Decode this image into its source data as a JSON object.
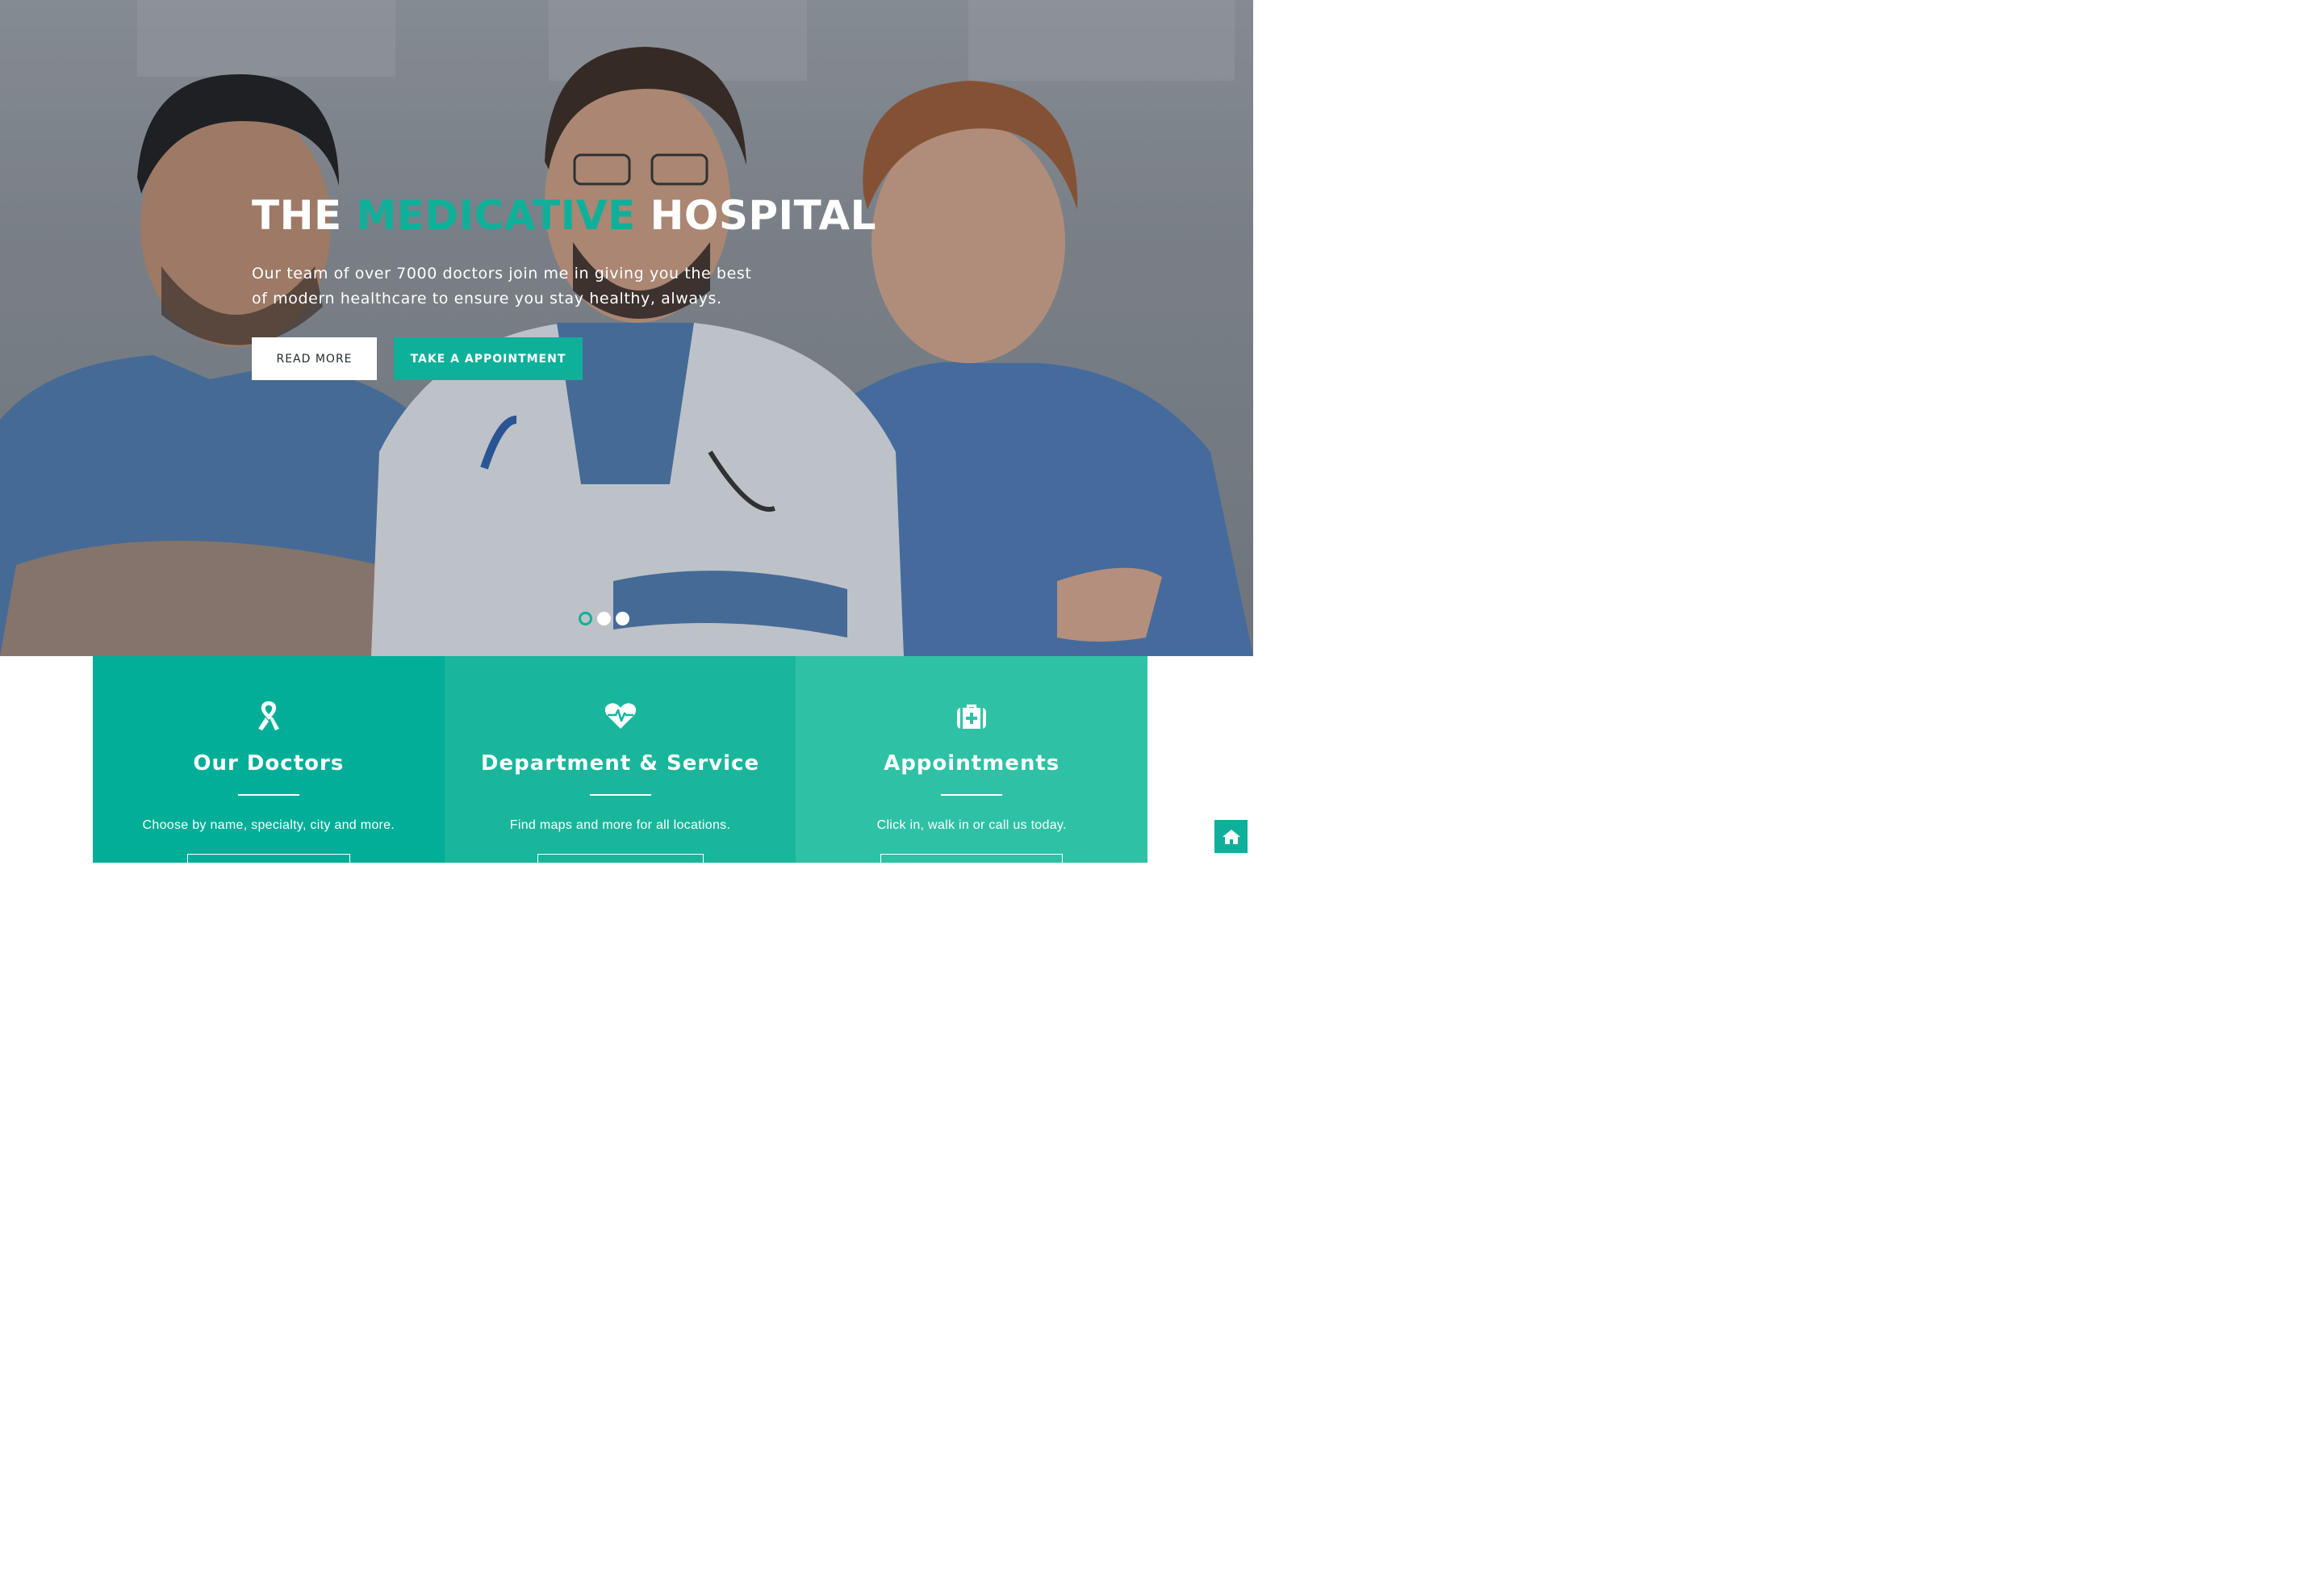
{
  "hero": {
    "title_pre": "THE",
    "title_accent": "MEDICATIVE",
    "title_post": "HOSPITAL",
    "subtitle": "Our team of over 7000 doctors join me in giving you the best of modern healthcare to ensure you stay healthy, always.",
    "buttons": {
      "read_more": "READ MORE",
      "appointment": "TAKE A APPOINTMENT"
    },
    "slider": {
      "slide_count": 3,
      "active_index": 0
    }
  },
  "features": [
    {
      "icon": "ribbon-icon",
      "title": "Our Doctors",
      "description": "Choose by name, specialty, city and more."
    },
    {
      "icon": "heartbeat-icon",
      "title": "Department & Service",
      "description": "Find maps and more for all locations."
    },
    {
      "icon": "medkit-icon",
      "title": "Appointments",
      "description": "Click in, walk in or call us today."
    }
  ],
  "colors": {
    "accent": "#0fb09a",
    "feature_1": "#02ae98",
    "feature_2": "#19b69c",
    "feature_3": "#2fc1a5"
  },
  "floating": {
    "icon": "home-icon"
  }
}
